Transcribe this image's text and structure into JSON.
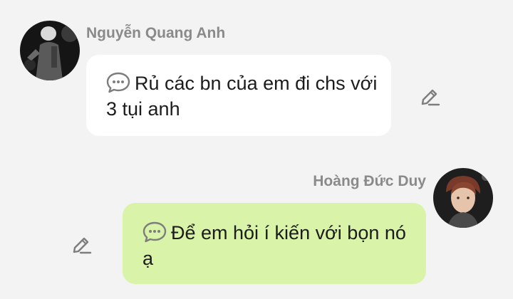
{
  "messages": [
    {
      "sender": "Nguyễn Quang Anh",
      "icon": "speech-bubble-icon",
      "text": "Rủ các bn của em đi chs với 3 tụi anh",
      "direction": "incoming",
      "bubble_color": "#ffffff"
    },
    {
      "sender": "Hoàng Đức Duy",
      "icon": "speech-bubble-icon",
      "text": "Để em hỏi í kiến với bọn nó ạ",
      "direction": "outgoing",
      "bubble_color": "#d9f3a8"
    }
  ],
  "colors": {
    "background": "#f3f3f3",
    "sender_name": "#8a8a8a",
    "icon_gray": "#7d7d7d"
  }
}
